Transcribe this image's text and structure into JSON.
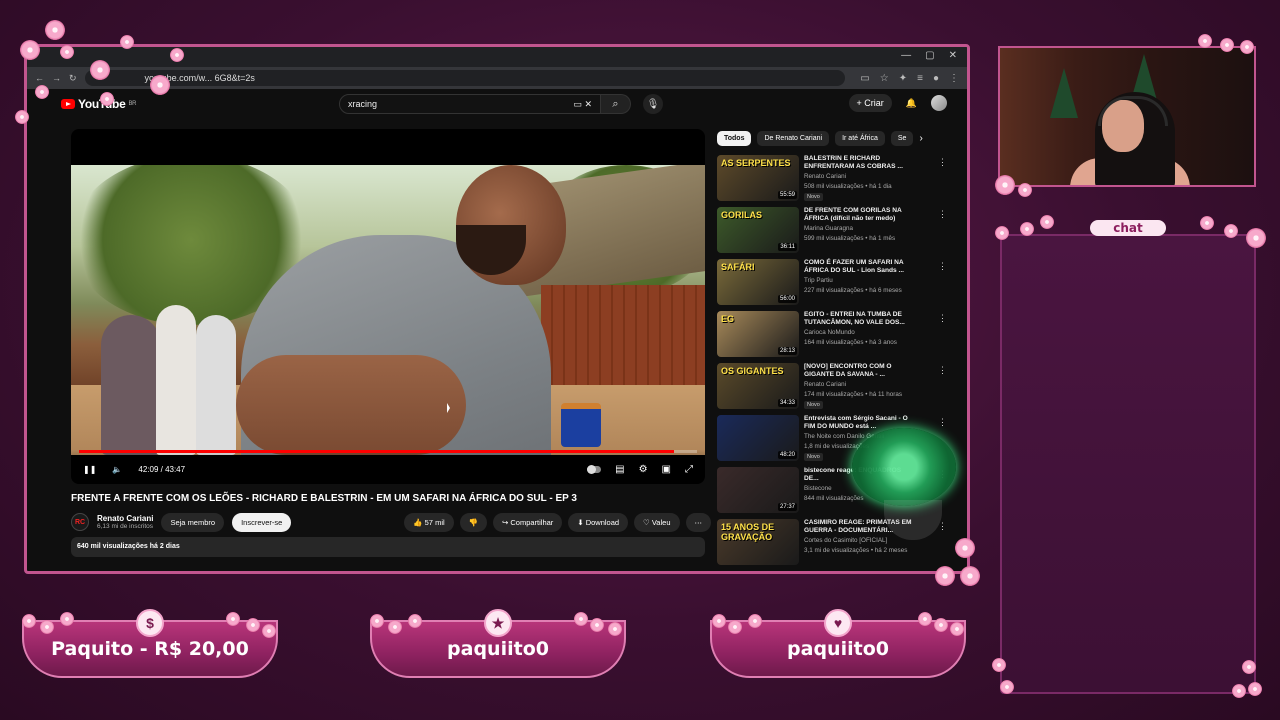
{
  "browser": {
    "url": "youtube.com/w...",
    "url_suffix": "6G8&t=2s",
    "window_controls": [
      "—",
      "▢",
      "✕"
    ]
  },
  "youtube": {
    "logo": "YouTube",
    "logo_region": "BR",
    "search_query": "xracing",
    "create_label": "Criar",
    "video": {
      "title": "FRENTE A FRENTE COM OS LEÕES - RICHARD E BALESTRIN - EM UM SAFARI NA ÁFRICA DO SUL - EP 3",
      "time_current": "42:09",
      "time_total": "43:47",
      "time_display": "42:09 / 43:47",
      "progress": 0.963,
      "channel_name": "Renato Cariani",
      "channel_avatar_text": "RC",
      "subscribers": "6,13 mi de inscritos",
      "join_label": "Seja membro",
      "subscribe_label": "Inscrever-se",
      "likes": "57 mil",
      "share_label": "Compartilhar",
      "download_label": "Download",
      "thanks_label": "Valeu",
      "views_date": "640 mil visualizações  há 2 dias"
    },
    "chips": [
      "Todos",
      "De Renato Cariani",
      "Ir até África",
      "Se"
    ],
    "recommendations": [
      {
        "title": "BALESTRIN E RICHARD ENFRENTARAM AS COBRAS ...",
        "channel": "Renato Cariani",
        "meta": "508 mil visualizações • há 1 dia",
        "badge": "Novo",
        "duration": "55:59",
        "thumb_text": "AS SERPENTES",
        "thumb_color": "#5d4a2a"
      },
      {
        "title": "DE FRENTE COM GORILAS NA ÁFRICA (difícil não ter medo)",
        "channel": "Marina Guaragna",
        "meta": "599 mil visualizações • há 1 mês",
        "badge": "",
        "duration": "36:11",
        "thumb_text": "GORILAS",
        "thumb_color": "#3d5a2a"
      },
      {
        "title": "COMO É FAZER UM SAFARI NA ÁFRICA DO SUL - Lion Sands ...",
        "channel": "Trip Partiu",
        "meta": "227 mil visualizações • há 6 meses",
        "badge": "",
        "duration": "56:00",
        "thumb_text": "SAFÁRI",
        "thumb_color": "#7a6a3a"
      },
      {
        "title": "EGITO - ENTREI NA TUMBA DE TUTANCÂMON, NO VALE DOS...",
        "channel": "Carioca NoMundo",
        "meta": "164 mil visualizações • há 3 anos",
        "badge": "",
        "duration": "28:13",
        "thumb_text": "EG",
        "thumb_color": "#a88a5a"
      },
      {
        "title": "[NOVO] ENCONTRO COM O GIGANTE DA SAVANA - ...",
        "channel": "Renato Cariani",
        "meta": "174 mil visualizações • há 11 horas",
        "badge": "Novo",
        "duration": "34:33",
        "thumb_text": "OS GIGANTES",
        "thumb_color": "#5a4a2a"
      },
      {
        "title": "Entrevista com Sérgio Sacani - O FIM DO MUNDO está ...",
        "channel": "The Noite com Danilo Gentili",
        "meta": "1,8 mi de visualizações",
        "badge": "Novo",
        "duration": "48:20",
        "thumb_text": "",
        "thumb_color": "#1a2a5a"
      },
      {
        "title": "bistecone reage: ENQUADROS DE...",
        "channel": "Bistecone",
        "meta": "844 mil visualizações",
        "badge": "",
        "duration": "27:37",
        "thumb_text": "",
        "thumb_color": "#3a2a2a"
      },
      {
        "title": "CASIMIRO REAGE: PRIMATAS EM GUERRA - DOCUMENTÁRI...",
        "channel": "Cortes do Casimito [OFICIAL]",
        "meta": "3,1 mi de visualizações • há 2 meses",
        "badge": "",
        "duration": "",
        "thumb_text": "15 ANOS DE GRAVAÇÃO",
        "thumb_color": "#4a3a2a"
      }
    ]
  },
  "stream": {
    "chat_label": "chat",
    "alerts": [
      {
        "icon": "$",
        "label": "Paquito - R$ 20,00"
      },
      {
        "icon": "★",
        "label": "paquiito0"
      },
      {
        "icon": "♥",
        "label": "paquiito0"
      }
    ],
    "accent_color": "#c2558f"
  }
}
